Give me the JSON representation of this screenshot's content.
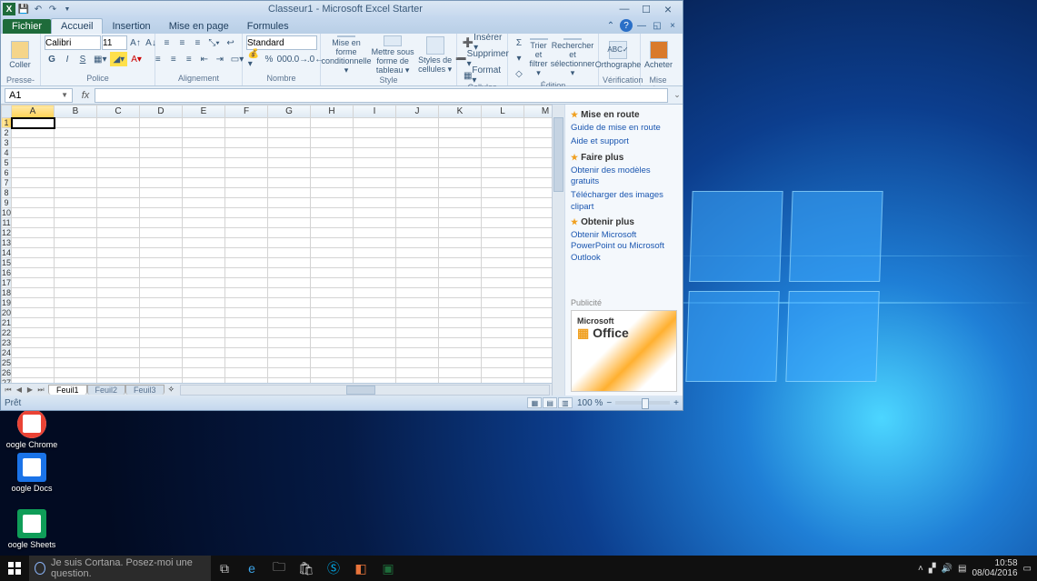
{
  "window": {
    "title": "Classeur1 - Microsoft Excel Starter",
    "qat": {
      "undo": "↶",
      "redo": "↷"
    }
  },
  "tabs": {
    "file": "Fichier",
    "items": [
      "Accueil",
      "Insertion",
      "Mise en page",
      "Formules"
    ],
    "active": "Accueil"
  },
  "ribbon": {
    "clipboard": {
      "paste": "Coller",
      "label": "Presse-pa..."
    },
    "font": {
      "name": "Calibri",
      "size": "11",
      "label": "Police"
    },
    "align": {
      "label": "Alignement"
    },
    "number": {
      "format": "Standard",
      "label": "Nombre"
    },
    "style": {
      "cond": "Mise en forme conditionnelle ▾",
      "table": "Mettre sous forme de tableau ▾",
      "cell": "Styles de cellules ▾",
      "label": "Style"
    },
    "cells": {
      "insert": "Insérer ▾",
      "delete": "Supprimer ▾",
      "format": "Format ▾",
      "label": "Cellules"
    },
    "editing": {
      "sort": "Trier et filtrer ▾",
      "find": "Rechercher et sélectionner ▾",
      "label": "Édition",
      "sum": "Σ",
      "fill": "▾",
      "clear": "◇"
    },
    "proof": {
      "spell": "Orthographe",
      "label": "Vérification"
    },
    "buy": {
      "buy": "Acheter",
      "label": "Mise à..."
    }
  },
  "formula": {
    "cell": "A1",
    "fx": "fx",
    "value": ""
  },
  "grid": {
    "cols": [
      "A",
      "B",
      "C",
      "D",
      "E",
      "F",
      "G",
      "H",
      "I",
      "J",
      "K",
      "L",
      "M"
    ],
    "rows": 27,
    "selected": "A1"
  },
  "sheets": {
    "tabs": [
      "Feuil1",
      "Feuil2",
      "Feuil3"
    ],
    "active": "Feuil1"
  },
  "statusbar": {
    "ready": "Prêt",
    "zoom": "100 %"
  },
  "pane": {
    "h1": "Mise en route",
    "l1": "Guide de mise en route",
    "l2": "Aide et support",
    "h2": "Faire plus",
    "l3": "Obtenir des modèles gratuits",
    "l4": "Télécharger des images clipart",
    "h3": "Obtenir plus",
    "l5": "Obtenir Microsoft PowerPoint ou Microsoft Outlook",
    "adlabel": "Publicité",
    "ad_ms": "Microsoft",
    "ad_office": "Office"
  },
  "desktop": {
    "chrome": "oogle Chrome",
    "docs": "oogle Docs",
    "sheets": "oogle Sheets"
  },
  "taskbar": {
    "search": "Je suis Cortana. Posez-moi une question.",
    "time": "10:58",
    "date": "08/04/2016"
  }
}
